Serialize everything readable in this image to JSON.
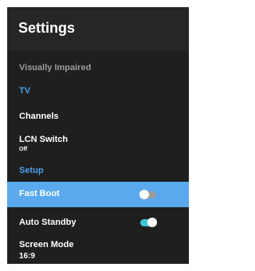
{
  "header": {
    "title": "Settings"
  },
  "menu": {
    "visually_impaired": "Visually Impaired",
    "section_tv": "TV",
    "channels": "Channels",
    "lcn_switch": {
      "label": "LCN Switch",
      "value": "Off"
    },
    "section_setup": "Setup",
    "fast_boot": {
      "label": "Fast Boot",
      "state": "off"
    },
    "auto_standby": {
      "label": "Auto Standby",
      "state": "on"
    },
    "screen_mode": {
      "label": "Screen Mode",
      "value": "16:9"
    }
  },
  "colors": {
    "panel_bg": "#1f1f1f",
    "header_bg": "#262626",
    "accent_blue": "#4a9ef0",
    "selected_row": "#5aa9ef",
    "toggle_on": "#3fc6d8"
  }
}
